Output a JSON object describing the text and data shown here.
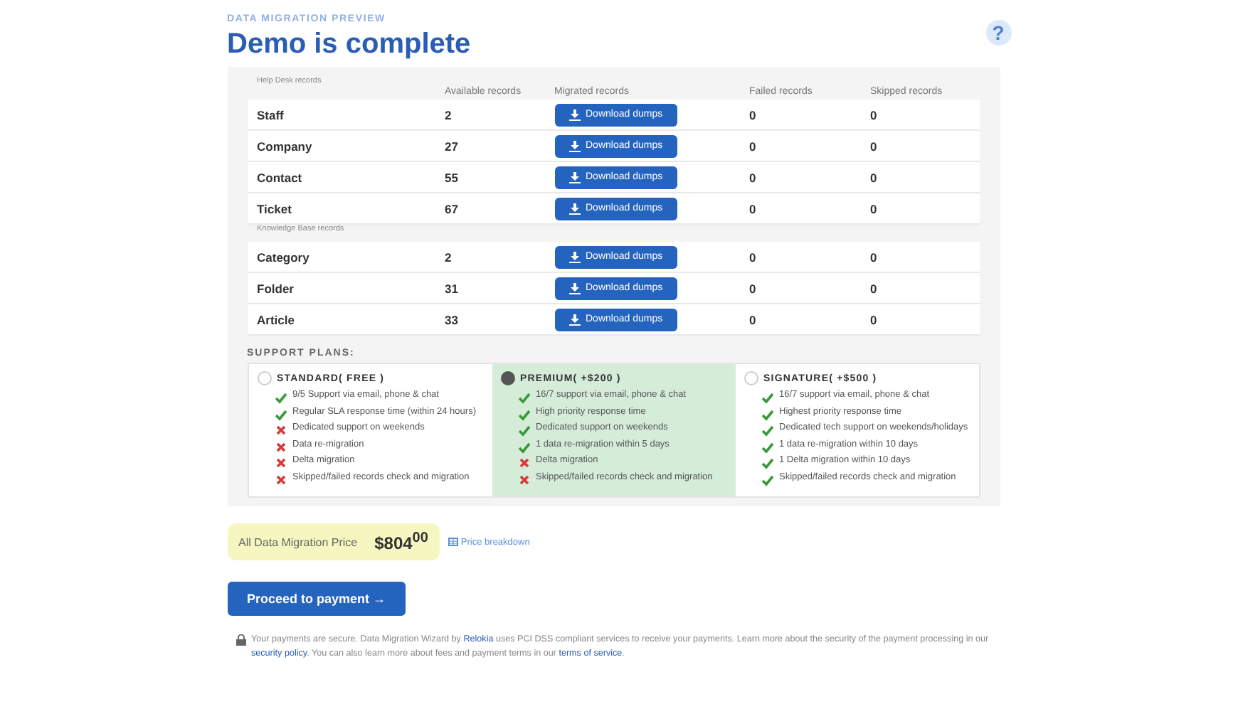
{
  "header": {
    "eyebrow": "DATA MIGRATION PREVIEW",
    "title": "Demo is complete",
    "help": "?"
  },
  "table": {
    "columns": [
      "Available records",
      "Migrated records",
      "Failed records",
      "Skipped records"
    ],
    "groups": [
      {
        "label": "Help Desk records",
        "rows": [
          {
            "name": "Staff",
            "available": "2",
            "action": "Download dumps",
            "failed": "0",
            "skipped": "0"
          },
          {
            "name": "Company",
            "available": "27",
            "action": "Download dumps",
            "failed": "0",
            "skipped": "0"
          },
          {
            "name": "Contact",
            "available": "55",
            "action": "Download dumps",
            "failed": "0",
            "skipped": "0"
          },
          {
            "name": "Ticket",
            "available": "67",
            "action": "Download dumps",
            "failed": "0",
            "skipped": "0"
          }
        ]
      },
      {
        "label": "Knowledge Base records",
        "rows": [
          {
            "name": "Category",
            "available": "2",
            "action": "Download dumps",
            "failed": "0",
            "skipped": "0"
          },
          {
            "name": "Folder",
            "available": "31",
            "action": "Download dumps",
            "failed": "0",
            "skipped": "0"
          },
          {
            "name": "Article",
            "available": "33",
            "action": "Download dumps",
            "failed": "0",
            "skipped": "0"
          }
        ]
      }
    ]
  },
  "plans": {
    "title": "SUPPORT PLANS:",
    "items": [
      {
        "name": "STANDARD( FREE )",
        "selected": false,
        "features": [
          {
            "text": "9/5 Support via email, phone & chat",
            "included": true
          },
          {
            "text": "Regular SLA response time (within 24 hours)",
            "included": true
          },
          {
            "text": "Dedicated support on weekends",
            "included": false
          },
          {
            "text": "Data re-migration",
            "included": false
          },
          {
            "text": "Delta migration",
            "included": false
          },
          {
            "text": "Skipped/failed records check and migration",
            "included": false
          }
        ]
      },
      {
        "name": "PREMIUM( +$200 )",
        "selected": true,
        "features": [
          {
            "text": "16/7 support via email, phone & chat",
            "included": true
          },
          {
            "text": "High priority response time",
            "included": true
          },
          {
            "text": "Dedicated support on weekends",
            "included": true
          },
          {
            "text": "1 data re-migration within 5 days",
            "included": true
          },
          {
            "text": "Delta migration",
            "included": false
          },
          {
            "text": "Skipped/failed records check and migration",
            "included": false
          }
        ]
      },
      {
        "name": "SIGNATURE( +$500 )",
        "selected": false,
        "features": [
          {
            "text": "16/7 support via email, phone & chat",
            "included": true
          },
          {
            "text": "Highest priority response time",
            "included": true
          },
          {
            "text": "Dedicated tech support on weekends/holidays",
            "included": true
          },
          {
            "text": "1 data re-migration within 10 days",
            "included": true
          },
          {
            "text": "1 Delta migration within 10 days",
            "included": true
          },
          {
            "text": "Skipped/failed records check and migration",
            "included": true
          }
        ]
      }
    ]
  },
  "price": {
    "label": "All Data Migration Price",
    "amount": "$804$^{00}$",
    "breakdown": "Price breakdown"
  },
  "proceed": "Proceed to payment →",
  "footer": [
    {
      "kind": "text",
      "text": "Your payments are secure. Data Migration Wizard by "
    },
    {
      "kind": "link",
      "text": "Relokia"
    },
    {
      "kind": "text",
      "text": " uses PCI DSS compliant services to receive your payments. Learn more about the security of the payment processing in our "
    },
    {
      "kind": "link",
      "text": "security policy"
    },
    {
      "kind": "text",
      "text": ". You can also learn more about fees and payment terms in our "
    },
    {
      "kind": "link",
      "text": "terms of service"
    },
    {
      "kind": "text",
      "text": "."
    }
  ]
}
